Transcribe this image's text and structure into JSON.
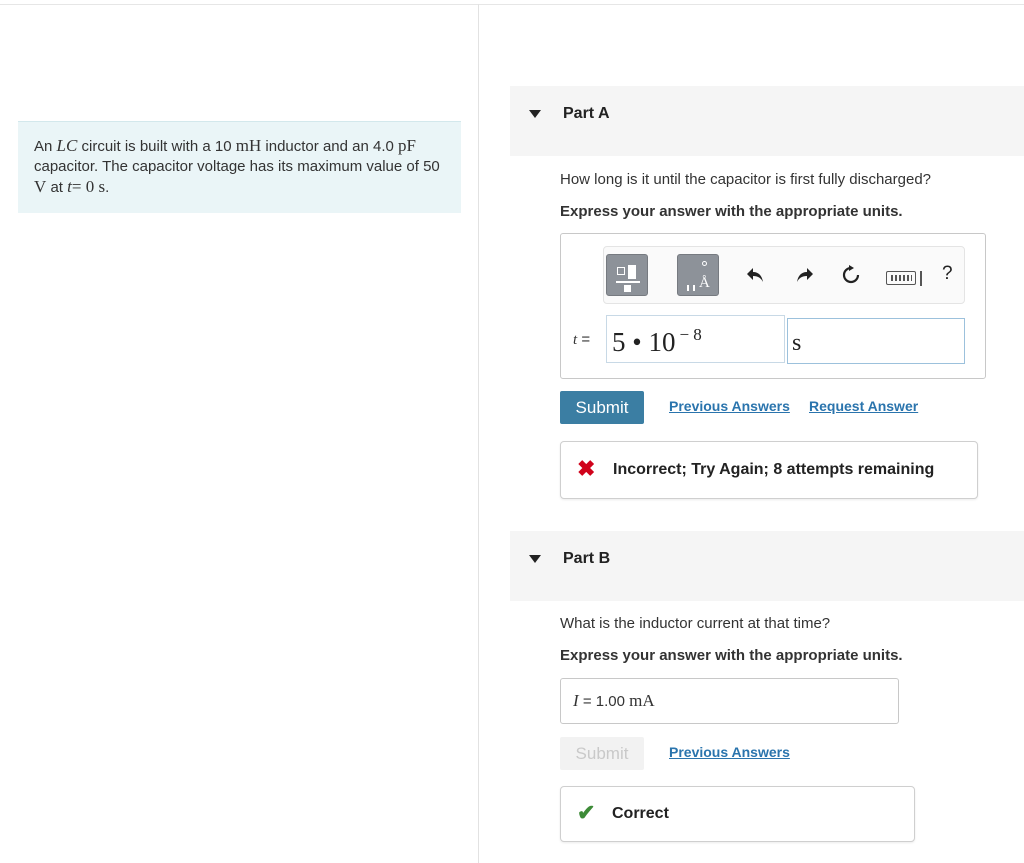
{
  "problem": {
    "text_1": "An",
    "math_lc": "LC",
    "text_2": "circuit is built with a 10",
    "math_mh": "mH",
    "text_3": "inductor and an 4.0",
    "math_pf": "pF",
    "text_4": "capacitor. The capacitor voltage has its maximum value of 50",
    "math_v": "V",
    "text_5": "at",
    "math_t": "t",
    "math_eq": "= 0 s",
    "text_6": "."
  },
  "part_a": {
    "title": "Part A",
    "question": "How long is it until the capacitor is first fully discharged?",
    "instruction": "Express your answer with the appropriate units.",
    "toolbar": {
      "templates_icon": "templates-icon",
      "units_icon": "units-icon",
      "units_glyph": "Å",
      "undo_icon": "undo-icon",
      "redo_icon": "redo-icon",
      "reset_icon": "reset-icon",
      "keyboard_icon": "keyboard-icon",
      "help_label": "?"
    },
    "var_label": "t",
    "equals": "=",
    "value_mantissa": "5 • 10",
    "value_exponent": "− 8",
    "unit_value": "s",
    "submit_label": "Submit",
    "previous_answers": "Previous Answers",
    "request_answer": "Request Answer",
    "feedback_icon": "✖",
    "feedback": "Incorrect; Try Again; 8 attempts remaining",
    "feedback_color": "#d0021b"
  },
  "part_b": {
    "title": "Part B",
    "question": "What is the inductor current at that time?",
    "instruction": "Express your answer with the appropriate units.",
    "var_label": "I",
    "equals": "=",
    "answer_value": "1.00",
    "answer_unit": "mA",
    "submit_label": "Submit",
    "previous_answers": "Previous Answers",
    "feedback_icon": "✔",
    "feedback": "Correct",
    "feedback_color": "#3d8b37"
  },
  "colors": {
    "accent": "#3b7ea3",
    "link": "#2a74ad",
    "problem_bg": "#eaf5f7"
  }
}
